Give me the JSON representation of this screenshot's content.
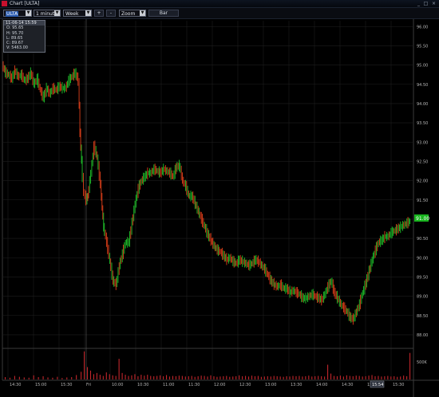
{
  "window": {
    "title": "Chart [ULTA]",
    "controls": {
      "minimize": "_",
      "maximize": "□",
      "close": "×"
    }
  },
  "toolbar": {
    "symbol": "ULTA",
    "interval": "1 minute",
    "range": "Week",
    "zoom_in": "+",
    "zoom_out": "-",
    "zoom": "Zoom",
    "chart_type": "Bar"
  },
  "ohlc_box": {
    "header": "11-06-14 15:59",
    "open": "O: 95.65",
    "high": "H: 95.70",
    "low": "L: 89.65",
    "close": "C: 89.67",
    "volume": "V: 5463.00"
  },
  "colors": {
    "background": "#000000",
    "up_bar": "#1fc32a",
    "down_bar": "#e0401a",
    "grid": "#1e1e1e",
    "axis_text": "#b8b8b8",
    "volume": "#c0262b",
    "price_tag": "#18b41e"
  },
  "chart_data": {
    "type": "line",
    "title": "",
    "price_axis": {
      "ylim": [
        87.75,
        96.15
      ],
      "ticks": [
        "96.00",
        "95.50",
        "95.00",
        "94.50",
        "94.00",
        "93.50",
        "93.00",
        "92.50",
        "92.00",
        "91.50",
        "91.00",
        "90.50",
        "90.00",
        "89.50",
        "89.00",
        "88.50",
        "88.00"
      ],
      "last_price_label": "91.00"
    },
    "volume_axis": {
      "ylim": [
        0,
        1000
      ],
      "ticks": [
        "500K"
      ]
    },
    "x_ticks": [
      "14:30",
      "15:00",
      "15:30",
      "Fri",
      "10:00",
      "10:30",
      "11:00",
      "11:30",
      "12:00",
      "12:30",
      "13:00",
      "13:30",
      "14:00",
      "14:30",
      "15:00",
      "15:30"
    ],
    "current_time_label": "15:54",
    "grid": true,
    "series": [
      {
        "x": [
          0,
          4,
          8,
          12,
          16,
          20,
          24,
          28,
          32,
          36,
          40,
          44,
          48,
          52,
          56,
          60,
          64,
          68,
          72,
          76,
          80,
          84,
          88,
          92,
          96,
          98,
          100,
          103,
          106,
          108,
          112,
          116,
          120,
          124,
          126,
          128,
          132,
          136,
          140,
          144,
          148,
          152,
          156,
          160,
          164,
          168,
          172,
          176,
          180,
          184,
          188,
          192,
          196,
          200,
          204,
          208,
          212,
          216,
          220,
          224,
          228,
          232,
          236,
          240,
          244,
          248,
          252,
          256,
          260,
          264,
          268,
          272,
          276,
          280,
          284,
          288,
          292,
          296,
          300,
          304,
          308,
          312,
          316,
          320,
          324,
          328,
          332,
          336,
          340,
          344,
          348,
          352,
          356,
          360,
          364,
          368,
          372,
          376,
          380,
          384,
          388,
          392,
          396,
          400,
          404,
          408,
          412,
          416,
          420,
          424,
          428,
          432,
          436,
          440,
          444,
          448,
          452,
          456,
          460,
          464,
          468,
          472,
          476,
          480,
          484,
          488,
          492,
          496,
          500,
          504,
          508,
          512,
          516
        ],
        "y": [
          95.0,
          94.8,
          94.75,
          94.65,
          94.85,
          94.7,
          94.75,
          94.6,
          94.65,
          94.8,
          94.5,
          94.65,
          94.35,
          94.15,
          94.4,
          94.25,
          94.4,
          94.35,
          94.45,
          94.4,
          94.4,
          94.6,
          94.7,
          94.8,
          94.6,
          93.25,
          92.5,
          91.7,
          91.5,
          91.6,
          92.2,
          92.9,
          92.6,
          91.9,
          91.3,
          90.8,
          90.4,
          89.9,
          89.4,
          89.3,
          89.8,
          90.1,
          90.4,
          90.4,
          90.9,
          91.4,
          91.8,
          92.0,
          92.1,
          92.2,
          92.2,
          92.3,
          92.25,
          92.2,
          92.3,
          92.25,
          92.2,
          92.1,
          92.35,
          92.4,
          92.0,
          91.85,
          91.6,
          91.6,
          91.4,
          91.2,
          91.0,
          90.8,
          90.6,
          90.45,
          90.3,
          90.2,
          90.15,
          90.05,
          89.95,
          90.0,
          89.9,
          89.85,
          89.95,
          89.9,
          89.85,
          89.8,
          89.85,
          89.95,
          89.9,
          89.8,
          89.7,
          89.55,
          89.4,
          89.3,
          89.25,
          89.3,
          89.2,
          89.2,
          89.1,
          89.15,
          89.1,
          89.05,
          88.95,
          88.95,
          89.0,
          89.05,
          89.0,
          88.95,
          88.9,
          89.05,
          89.25,
          89.4,
          89.1,
          88.95,
          88.8,
          88.7,
          88.6,
          88.45,
          88.4,
          88.6,
          88.8,
          89.1,
          89.35,
          89.65,
          89.95,
          90.2,
          90.4,
          90.45,
          90.55,
          90.55,
          90.65,
          90.7,
          90.75,
          90.8,
          90.85,
          90.9,
          90.95
        ]
      }
    ],
    "volume": {
      "x": [
        2,
        8,
        14,
        20,
        26,
        32,
        38,
        44,
        50,
        56,
        62,
        68,
        74,
        80,
        86,
        92,
        98,
        102,
        106,
        110,
        114,
        118,
        122,
        126,
        130,
        134,
        138,
        142,
        146,
        150,
        154,
        158,
        162,
        166,
        170,
        174,
        178,
        182,
        186,
        190,
        194,
        198,
        202,
        206,
        210,
        214,
        218,
        222,
        226,
        230,
        234,
        238,
        242,
        246,
        250,
        254,
        258,
        262,
        266,
        270,
        274,
        278,
        282,
        286,
        290,
        294,
        298,
        302,
        306,
        310,
        314,
        318,
        322,
        326,
        330,
        334,
        338,
        342,
        346,
        350,
        354,
        358,
        362,
        366,
        370,
        374,
        378,
        382,
        386,
        390,
        394,
        398,
        402,
        406,
        410,
        414,
        418,
        422,
        426,
        430,
        434,
        438,
        442,
        446,
        450,
        454,
        458,
        462,
        466,
        470,
        474,
        478,
        482,
        486,
        490,
        494,
        498,
        502,
        506,
        510,
        514
      ],
      "y": [
        80,
        60,
        120,
        90,
        70,
        60,
        140,
        80,
        110,
        70,
        60,
        90,
        50,
        70,
        80,
        150,
        260,
        950,
        420,
        300,
        180,
        220,
        160,
        120,
        240,
        180,
        140,
        120,
        700,
        220,
        160,
        120,
        140,
        180,
        110,
        160,
        130,
        160,
        120,
        110,
        120,
        140,
        110,
        150,
        100,
        120,
        110,
        130,
        120,
        100,
        110,
        120,
        90,
        110,
        130,
        120,
        100,
        140,
        110,
        90,
        100,
        110,
        120,
        90,
        100,
        110,
        140,
        110,
        120,
        100,
        130,
        110,
        120,
        90,
        100,
        110,
        100,
        120,
        110,
        100,
        90,
        110,
        100,
        120,
        110,
        120,
        100,
        110,
        130,
        100,
        110,
        120,
        110,
        100,
        500,
        200,
        120,
        110,
        130,
        100,
        140,
        120,
        110,
        130,
        120,
        100,
        110,
        130,
        150,
        110,
        120,
        100,
        110,
        120,
        100,
        110,
        90,
        100,
        130,
        110,
        900
      ]
    }
  }
}
